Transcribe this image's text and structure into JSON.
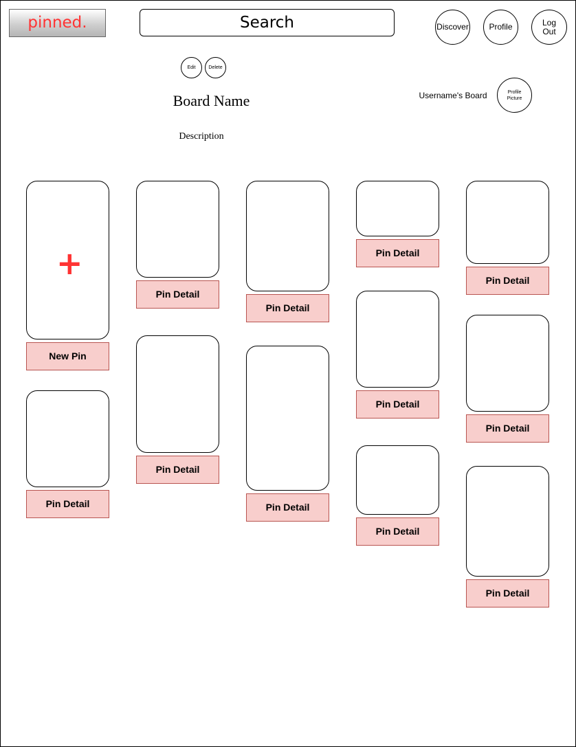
{
  "header": {
    "logo": "pinned.",
    "search_placeholder": "Search",
    "nav": {
      "discover": "Discover",
      "profile": "Profile",
      "logout": "Log Out"
    }
  },
  "board": {
    "edit_label": "Edit",
    "delete_label": "Delete",
    "name": "Board Name",
    "description": "Description",
    "owner": "Username's Board",
    "profile_picture": "Profile Picture"
  },
  "pins": {
    "new_pin": {
      "label": "New Pin",
      "icon": "plus-icon",
      "color": "#ff3333"
    },
    "detail_label": "Pin Detail",
    "label_fill": "#f8cecc",
    "label_border": "#b85450"
  }
}
